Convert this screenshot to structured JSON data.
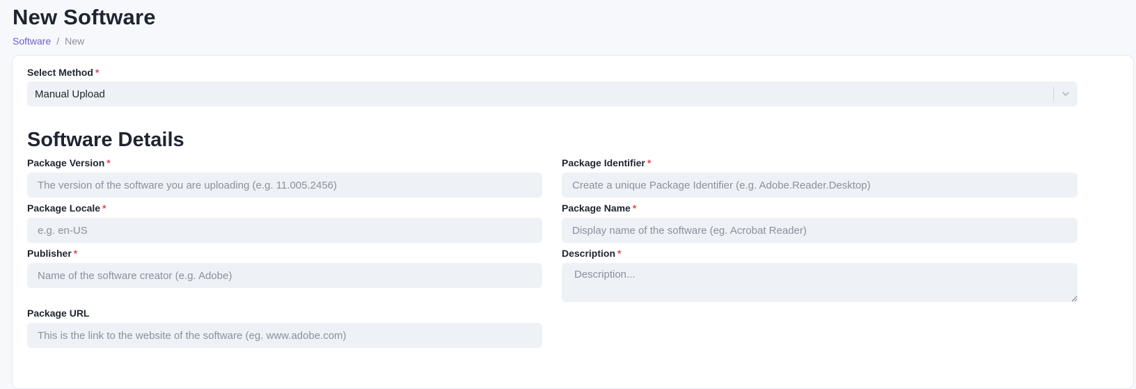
{
  "header": {
    "title": "New Software",
    "breadcrumb": {
      "parent": "Software",
      "separator": "/",
      "current": "New"
    }
  },
  "form": {
    "method": {
      "label": "Select Method",
      "required_mark": "*",
      "value": "Manual Upload"
    },
    "section_title": "Software Details",
    "fields": {
      "package_version": {
        "label": "Package Version",
        "required_mark": "*",
        "placeholder": "The version of the software you are uploading (e.g. 11.005.2456)"
      },
      "package_identifier": {
        "label": "Package Identifier",
        "required_mark": "*",
        "placeholder": "Create a unique Package Identifier (e.g. Adobe.Reader.Desktop)"
      },
      "package_locale": {
        "label": "Package Locale",
        "required_mark": "*",
        "placeholder": "e.g. en-US"
      },
      "package_name": {
        "label": "Package Name",
        "required_mark": "*",
        "placeholder": "Display name of the software (eg. Acrobat Reader)"
      },
      "publisher": {
        "label": "Publisher",
        "required_mark": "*",
        "placeholder": "Name of the software creator (e.g. Adobe)"
      },
      "description": {
        "label": "Description",
        "required_mark": "*",
        "placeholder": "Description..."
      },
      "package_url": {
        "label": "Package URL",
        "placeholder": "This is the link to the website of the software (eg. www.adobe.com)"
      }
    }
  },
  "colors": {
    "accent": "#6a5cd8",
    "required": "#e5484d",
    "input_background": "#eef1f5",
    "page_background": "#f6f8fb"
  },
  "icons": {
    "select_chevron": "chevron-down-icon"
  }
}
